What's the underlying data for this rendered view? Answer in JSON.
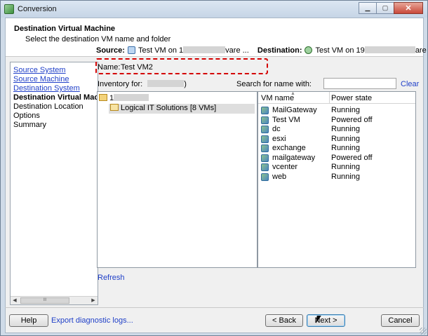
{
  "window": {
    "title": "Conversion",
    "controls": {
      "minimize": "▁",
      "maximize": "▢",
      "close": "✕"
    }
  },
  "header": {
    "title": "Destination Virtual Machine",
    "subtitle": "Select the destination VM name and folder"
  },
  "steps": [
    {
      "label": "Source System",
      "state": "link"
    },
    {
      "label": "Source Machine",
      "state": "link"
    },
    {
      "label": "Destination System",
      "state": "link"
    },
    {
      "label": "Destination Virtual Machine",
      "state": "current"
    },
    {
      "label": "Destination Location",
      "state": "plain"
    },
    {
      "label": "Options",
      "state": "plain"
    },
    {
      "label": "Summary",
      "state": "plain"
    }
  ],
  "scrollbar": {
    "thumb_grip": "III",
    "left_arrow": "◀",
    "right_arrow": "▶"
  },
  "source": {
    "label": "Source:",
    "prefix": "Test VM on 1",
    "suffix": "vare ..."
  },
  "destination": {
    "label": "Destination:",
    "prefix": "Test VM on 19",
    "suffix": "are ..."
  },
  "name_field": {
    "label": "Name:",
    "value": "Test VM2"
  },
  "inventory": {
    "label": "Inventory for:",
    "suffix": ")"
  },
  "search": {
    "label": "Search for name with:",
    "value": "",
    "clear_label": "Clear"
  },
  "tree": {
    "root_prefix": "1",
    "child_label": "Logical IT Solutions [8 VMs]"
  },
  "vm_table": {
    "columns": [
      "VM name",
      "Power state"
    ],
    "sort_arrow": "▲",
    "rows": [
      {
        "name": "MailGateway",
        "state": "Running"
      },
      {
        "name": "Test VM",
        "state": "Powered off"
      },
      {
        "name": "dc",
        "state": "Running"
      },
      {
        "name": "esxi",
        "state": "Running"
      },
      {
        "name": "exchange",
        "state": "Running"
      },
      {
        "name": "mailgateway",
        "state": "Powered off"
      },
      {
        "name": "vcenter",
        "state": "Running"
      },
      {
        "name": "web",
        "state": "Running"
      }
    ]
  },
  "refresh_label": "Refresh",
  "footer": {
    "help_label": "Help",
    "export_label": "Export diagnostic logs...",
    "back_label": "< Back",
    "next_label": "Next >",
    "cancel_label": "Cancel"
  }
}
